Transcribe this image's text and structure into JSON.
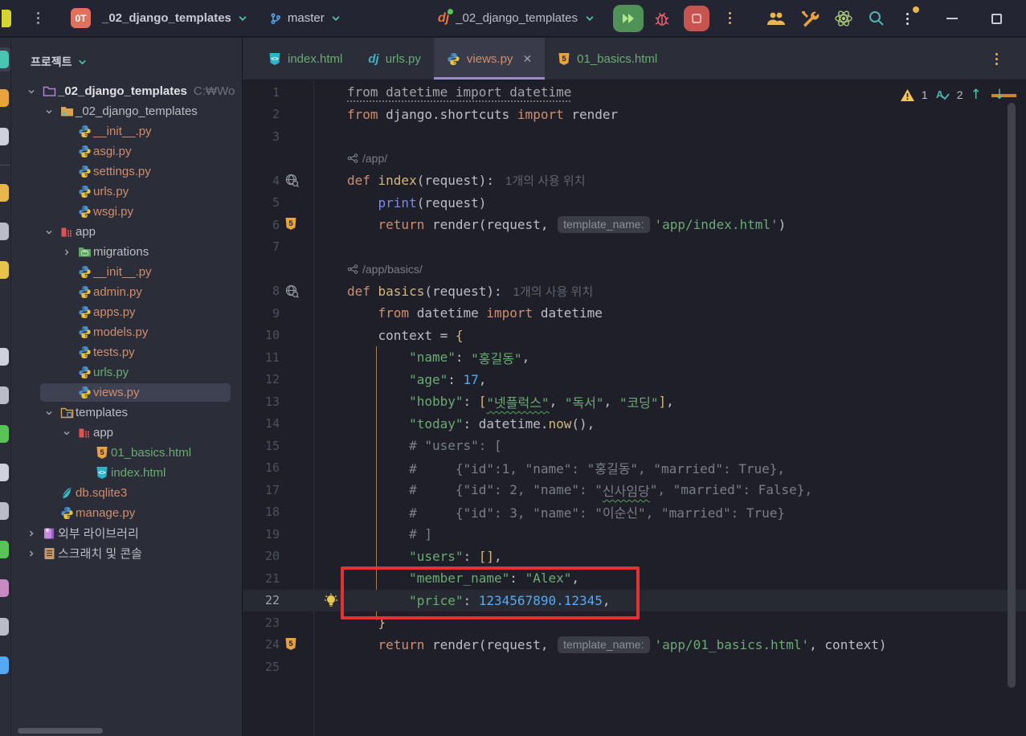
{
  "titlebar": {
    "project_badge": "0T",
    "project_name": "_02_django_templates",
    "branch_name": "master",
    "run_config": "_02_django_templates"
  },
  "tabbar": {
    "tabs": [
      {
        "label": "index.html",
        "icon": "html-file-icon",
        "cls": "green",
        "active": false
      },
      {
        "label": "urls.py",
        "icon": "django-file-icon",
        "cls": "green",
        "active": false
      },
      {
        "label": "views.py",
        "icon": "python-icon",
        "cls": "salmon",
        "active": true,
        "close": "✕"
      },
      {
        "label": "01_basics.html",
        "icon": "html5-icon",
        "cls": "green",
        "active": false
      }
    ]
  },
  "project_panel": {
    "header": "프로젝트",
    "items": [
      {
        "lvl": 0,
        "chev": "open",
        "icon": "project-folder-icon",
        "label": "_02_django_templates",
        "cls": "t-root",
        "extra": "C:₩Wo"
      },
      {
        "lvl": 1,
        "chev": "open",
        "icon": "folder-icon",
        "label": "_02_django_templates",
        "cls": ""
      },
      {
        "lvl": 2,
        "chev": "",
        "icon": "python-icon",
        "label": "__init__.py",
        "cls": "t-file"
      },
      {
        "lvl": 2,
        "chev": "",
        "icon": "python-icon",
        "label": "asgi.py",
        "cls": "t-file"
      },
      {
        "lvl": 2,
        "chev": "",
        "icon": "python-icon",
        "label": "settings.py",
        "cls": "t-file"
      },
      {
        "lvl": 2,
        "chev": "",
        "icon": "python-icon",
        "label": "urls.py",
        "cls": "t-file"
      },
      {
        "lvl": 2,
        "chev": "",
        "icon": "python-icon",
        "label": "wsgi.py",
        "cls": "t-file"
      },
      {
        "lvl": 1,
        "chev": "open",
        "icon": "app-package-icon",
        "label": "app",
        "cls": ""
      },
      {
        "lvl": 2,
        "chev": "closed",
        "icon": "migrations-icon",
        "label": "migrations",
        "cls": ""
      },
      {
        "lvl": 2,
        "chev": "",
        "icon": "python-icon",
        "label": "__init__.py",
        "cls": "t-file"
      },
      {
        "lvl": 2,
        "chev": "",
        "icon": "python-icon",
        "label": "admin.py",
        "cls": "t-file"
      },
      {
        "lvl": 2,
        "chev": "",
        "icon": "python-icon",
        "label": "apps.py",
        "cls": "t-file"
      },
      {
        "lvl": 2,
        "chev": "",
        "icon": "python-icon",
        "label": "models.py",
        "cls": "t-file"
      },
      {
        "lvl": 2,
        "chev": "",
        "icon": "python-icon",
        "label": "tests.py",
        "cls": "t-file"
      },
      {
        "lvl": 2,
        "chev": "",
        "icon": "python-icon",
        "label": "urls.py",
        "cls": "t-green"
      },
      {
        "lvl": 2,
        "chev": "",
        "icon": "python-icon",
        "label": "views.py",
        "cls": "t-file",
        "selected": true
      },
      {
        "lvl": 1,
        "chev": "open",
        "icon": "templates-folder-icon",
        "label": "templates",
        "cls": ""
      },
      {
        "lvl": 2,
        "chev": "open",
        "icon": "app-package-icon",
        "label": "app",
        "cls": ""
      },
      {
        "lvl": 3,
        "chev": "",
        "icon": "html5-icon",
        "label": "01_basics.html",
        "cls": "t-green"
      },
      {
        "lvl": 3,
        "chev": "",
        "icon": "html-file-icon",
        "label": "index.html",
        "cls": "t-green"
      },
      {
        "lvl": 1,
        "chev": "",
        "icon": "sqlite-icon",
        "label": "db.sqlite3",
        "cls": "t-file"
      },
      {
        "lvl": 1,
        "chev": "",
        "icon": "python-icon",
        "label": "manage.py",
        "cls": "t-file"
      },
      {
        "lvl": 0,
        "chev": "closed",
        "icon": "library-icon",
        "label": "외부 라이브러리",
        "cls": ""
      },
      {
        "lvl": 0,
        "chev": "closed",
        "icon": "scratch-icon",
        "label": "스크래치 및 콘솔",
        "cls": ""
      }
    ]
  },
  "editor": {
    "inspection": {
      "warnings": "1",
      "typos": "2",
      "up": "↑",
      "down": "↓"
    },
    "rows": [
      {
        "n": "1",
        "segs": [
          [
            "u",
            "from datetime import datetime"
          ]
        ]
      },
      {
        "n": "2",
        "segs": [
          [
            "k",
            "from"
          ],
          [
            "t",
            " django.shortcuts "
          ],
          [
            "k",
            "import"
          ],
          [
            "t",
            " render"
          ]
        ]
      },
      {
        "n": "3",
        "segs": []
      },
      {
        "inlay": "/app/"
      },
      {
        "n": "4",
        "g": "usage-icon",
        "segs": [
          [
            "k",
            "def "
          ],
          [
            "f",
            "index"
          ],
          [
            "t",
            "(request):"
          ],
          [
            "h",
            "1개의 사용 위치"
          ]
        ]
      },
      {
        "n": "5",
        "segs": [
          [
            "t",
            "    "
          ],
          [
            "b",
            "print"
          ],
          [
            "t",
            "(request)"
          ]
        ]
      },
      {
        "n": "6",
        "g": "html5-icon",
        "segs": [
          [
            "t",
            "    "
          ],
          [
            "k",
            "return"
          ],
          [
            "t",
            " render(request, "
          ],
          [
            "chip",
            "template_name:"
          ],
          [
            "s",
            "'app/index.html'"
          ],
          [
            "t",
            ")"
          ]
        ]
      },
      {
        "n": "7",
        "segs": []
      },
      {
        "inlay": "/app/basics/"
      },
      {
        "n": "8",
        "g": "usage-icon",
        "segs": [
          [
            "k",
            "def "
          ],
          [
            "f",
            "basics"
          ],
          [
            "t",
            "(request):"
          ],
          [
            "h",
            "1개의 사용 위치"
          ]
        ]
      },
      {
        "n": "9",
        "segs": [
          [
            "t",
            "    "
          ],
          [
            "k",
            "from"
          ],
          [
            "t",
            " datetime "
          ],
          [
            "k",
            "import"
          ],
          [
            "t",
            " datetime"
          ]
        ]
      },
      {
        "n": "10",
        "segs": [
          [
            "t",
            "    context = "
          ],
          [
            "y",
            "{"
          ]
        ]
      },
      {
        "n": "11",
        "segs": [
          [
            "t",
            "        "
          ],
          [
            "s",
            "\"name\""
          ],
          [
            "t",
            ": "
          ],
          [
            "s",
            "\"홍길동\""
          ],
          [
            "t",
            ","
          ]
        ]
      },
      {
        "n": "12",
        "segs": [
          [
            "t",
            "        "
          ],
          [
            "s",
            "\"age\""
          ],
          [
            "t",
            ": "
          ],
          [
            "num",
            "17"
          ],
          [
            "t",
            ","
          ]
        ]
      },
      {
        "n": "13",
        "segs": [
          [
            "t",
            "        "
          ],
          [
            "s",
            "\"hobby\""
          ],
          [
            "t",
            ": "
          ],
          [
            "y",
            "["
          ],
          [
            "sq",
            "\"넷플럭스\""
          ],
          [
            "t",
            ", "
          ],
          [
            "s",
            "\"독서\""
          ],
          [
            "t",
            ", "
          ],
          [
            "s",
            "\"코딩\""
          ],
          [
            "y",
            "]"
          ],
          [
            "t",
            ","
          ]
        ]
      },
      {
        "n": "14",
        "segs": [
          [
            "t",
            "        "
          ],
          [
            "s",
            "\"today\""
          ],
          [
            "t",
            ": datetime."
          ],
          [
            "f",
            "now"
          ],
          [
            "t",
            "(),"
          ]
        ]
      },
      {
        "n": "15",
        "segs": [
          [
            "t",
            "        "
          ],
          [
            "c",
            "# \"users\": ["
          ]
        ]
      },
      {
        "n": "16",
        "segs": [
          [
            "t",
            "        "
          ],
          [
            "c",
            "#     {\"id\":1, \"name\": \"홍길동\", \"married\": True},"
          ]
        ]
      },
      {
        "n": "17",
        "segs": [
          [
            "t",
            "        "
          ],
          [
            "c",
            "#     {\"id\": 2, \"name\": \""
          ],
          [
            "csq",
            "신사임당"
          ],
          [
            "c",
            "\", \"married\": False},"
          ]
        ]
      },
      {
        "n": "18",
        "segs": [
          [
            "t",
            "        "
          ],
          [
            "c",
            "#     {\"id\": 3, \"name\": \"이순신\", \"married\": True}"
          ]
        ]
      },
      {
        "n": "19",
        "segs": [
          [
            "t",
            "        "
          ],
          [
            "c",
            "# ]"
          ]
        ]
      },
      {
        "n": "20",
        "segs": [
          [
            "t",
            "        "
          ],
          [
            "s",
            "\"users\""
          ],
          [
            "t",
            ": "
          ],
          [
            "y",
            "[]"
          ],
          [
            "t",
            ","
          ]
        ]
      },
      {
        "n": "21",
        "segs": [
          [
            "t",
            "        "
          ],
          [
            "s",
            "\"member_name\""
          ],
          [
            "t",
            ": "
          ],
          [
            "s",
            "\"Alex\""
          ],
          [
            "t",
            ","
          ]
        ]
      },
      {
        "n": "22",
        "g": "bulb-icon",
        "cur": true,
        "segs": [
          [
            "t",
            "        "
          ],
          [
            "s",
            "\"price\""
          ],
          [
            "t",
            ": "
          ],
          [
            "num",
            "1234567890.12345"
          ],
          [
            "t",
            ","
          ]
        ]
      },
      {
        "n": "23",
        "segs": [
          [
            "t",
            "    "
          ],
          [
            "y",
            "}"
          ]
        ]
      },
      {
        "n": "24",
        "g": "html5-icon",
        "segs": [
          [
            "t",
            "    "
          ],
          [
            "k",
            "return"
          ],
          [
            "t",
            " render(request, "
          ],
          [
            "chip",
            "template_name:"
          ],
          [
            "s",
            "'app/01_basics.html'"
          ],
          [
            "t",
            ", context)"
          ]
        ]
      },
      {
        "n": "25",
        "segs": []
      }
    ]
  },
  "activity_bar": {
    "top": [
      {
        "icon": "project-icon",
        "color": "#49c5b2",
        "active": true
      },
      {
        "icon": "bookmark-icon",
        "color": "#e8a33d"
      },
      {
        "icon": "commit-icon",
        "color": "#cfd2da"
      },
      {
        "icon": "divider"
      },
      {
        "icon": "structure-icon",
        "color": "#e8b64c"
      },
      {
        "icon": "find-icon",
        "color": "#b9bdc7"
      },
      {
        "icon": "breakpoint-icon",
        "color": "#e8c34c"
      }
    ],
    "bottom": [
      {
        "icon": "github-icon",
        "color": "#cfd2da"
      },
      {
        "icon": "terminal-icon",
        "color": "#b9bdc7"
      },
      {
        "icon": "version-control-icon",
        "color": "#57c455"
      },
      {
        "icon": "pull-request-icon",
        "color": "#cfd2da"
      },
      {
        "icon": "services-icon",
        "color": "#b9bdc7"
      },
      {
        "icon": "python-packages-icon",
        "color": "#57c455"
      },
      {
        "icon": "sciview-icon",
        "color": "#c98ac2"
      },
      {
        "icon": "jupyter-icon",
        "color": "#b9bdc7"
      },
      {
        "icon": "todo-icon",
        "color": "#56a8f5"
      }
    ]
  }
}
